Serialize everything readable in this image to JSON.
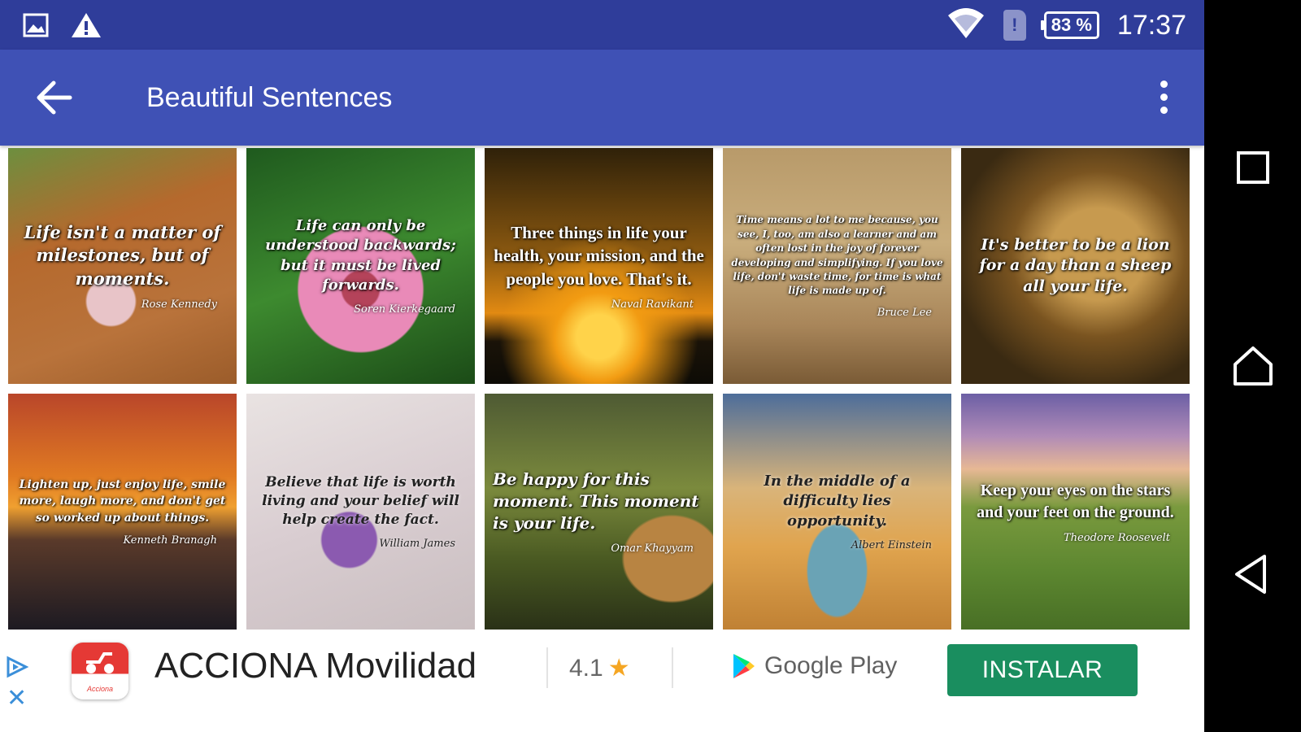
{
  "status_bar": {
    "time": "17:37",
    "battery": "83 %",
    "sim_label": "!",
    "icons": [
      "image-icon",
      "warning-icon",
      "wifi-icon",
      "sim-icon",
      "battery-icon"
    ]
  },
  "app_bar": {
    "title": "Beautiful Sentences",
    "color": "#3f51b5"
  },
  "tiles": [
    {
      "quote": "Life isn't a matter of milestones, but of moments.",
      "author": "Rose Kennedy"
    },
    {
      "quote": "Life can only be understood backwards; but it must be lived forwards.",
      "author": "Soren Kierkegaard"
    },
    {
      "quote": "Three things in life your health, your mission, and the people you love. That's it.",
      "author": "Naval Ravikant"
    },
    {
      "quote": "Time means a lot to me because, you see, I, too, am also a learner and am often lost in the joy of forever developing and simplifying. If you love life, don't waste time, for time is what life is made up of.",
      "author": "Bruce Lee"
    },
    {
      "quote": "It's better to be a lion for a day than a sheep all your life.",
      "author": ""
    },
    {
      "quote": "Lighten up, just enjoy life, smile more, laugh more, and don't get so worked up about things.",
      "author": "Kenneth Branagh"
    },
    {
      "quote": "Believe that life is worth living and your belief will help create the fact.",
      "author": "William James"
    },
    {
      "quote": "Be happy for this moment. This moment is your life.",
      "author": "Omar Khayyam"
    },
    {
      "quote": "In the middle of a difficulty lies opportunity.",
      "author": "Albert Einstein"
    },
    {
      "quote": "Keep your eyes on the stars and your feet on the ground.",
      "author": "Theodore Roosevelt"
    }
  ],
  "ad": {
    "app_name": "ACCIONA Movilidad",
    "icon_text": "Acciona",
    "rating": "4.1",
    "store": "Google Play",
    "install_label": "INSTALAR",
    "install_color": "#1a8e5f"
  },
  "nav_bar": {
    "buttons": [
      "recents-icon",
      "home-icon",
      "back-icon"
    ]
  }
}
